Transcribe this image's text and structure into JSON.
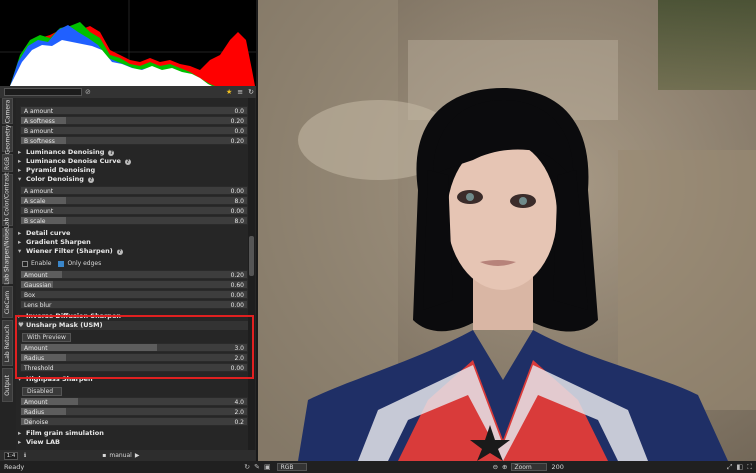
{
  "search": {
    "placeholder": ""
  },
  "tabs": [
    "Camera",
    "Geometry",
    "RGB",
    "Lab Color/Contrast",
    "Lab Sharpen/Noise",
    "CieCam",
    "Lab Retouch",
    "Output"
  ],
  "sliders_top": [
    {
      "label": "A amount",
      "value": "0.0"
    },
    {
      "label": "A softness",
      "value": "0.20"
    },
    {
      "label": "B amount",
      "value": "0.0"
    },
    {
      "label": "B softness",
      "value": "0.20"
    }
  ],
  "sections_a": [
    {
      "label": "Luminance Denoising",
      "help": true
    },
    {
      "label": "Luminance Denoise Curve",
      "help": true
    },
    {
      "label": "Pyramid Denoising",
      "help": false
    },
    {
      "label": "Color Denoising",
      "help": true
    }
  ],
  "color_sliders": [
    {
      "label": "A amount",
      "value": "0.00"
    },
    {
      "label": "A scale",
      "value": "8.0"
    },
    {
      "label": "B amount",
      "value": "0.00"
    },
    {
      "label": "B scale",
      "value": "8.0"
    }
  ],
  "sections_b": [
    {
      "label": "Detail curve"
    },
    {
      "label": "Gradient Sharpen"
    }
  ],
  "wiener": {
    "title": "Wiener Filter (Sharpen)",
    "enable_label": "Enable",
    "only_edges_label": "Only edges",
    "sliders": [
      {
        "label": "Amount",
        "value": "0.20"
      },
      {
        "label": "Gaussian",
        "value": "0.60"
      },
      {
        "label": "Box",
        "value": "0.00"
      },
      {
        "label": "Lens blur",
        "value": "0.00"
      }
    ]
  },
  "inverse_title": "Inverse Diffusion Sharpen",
  "usm": {
    "title": "Unsharp Mask (USM)",
    "preview_label": "With Preview",
    "sliders": [
      {
        "label": "Amount",
        "value": "3.0",
        "fill": 0.6
      },
      {
        "label": "Radius",
        "value": "2.0",
        "fill": 0.2
      },
      {
        "label": "Threshold",
        "value": "0.00",
        "fill": 0.0
      }
    ]
  },
  "highpass": {
    "title": "Highpass Sharpen",
    "mode": "Disabled",
    "sliders": [
      {
        "label": "Amount",
        "value": "4.0",
        "fill": 0.25
      },
      {
        "label": "Radius",
        "value": "2.0",
        "fill": 0.2
      },
      {
        "label": "Denoise",
        "value": "0.2",
        "fill": 0.05
      }
    ]
  },
  "sections_c": [
    {
      "label": "Film grain simulation"
    },
    {
      "label": "View LAB"
    }
  ],
  "bottom": {
    "zoom": "1:4",
    "mode": "manual"
  },
  "status": {
    "text": "Ready",
    "color_mode": "RGB",
    "zoom_label": "Zoom",
    "zoom_value": "200"
  },
  "colors": {
    "highlight": "#e02020",
    "accent": "#3a86c9",
    "star": "#f0c020"
  }
}
